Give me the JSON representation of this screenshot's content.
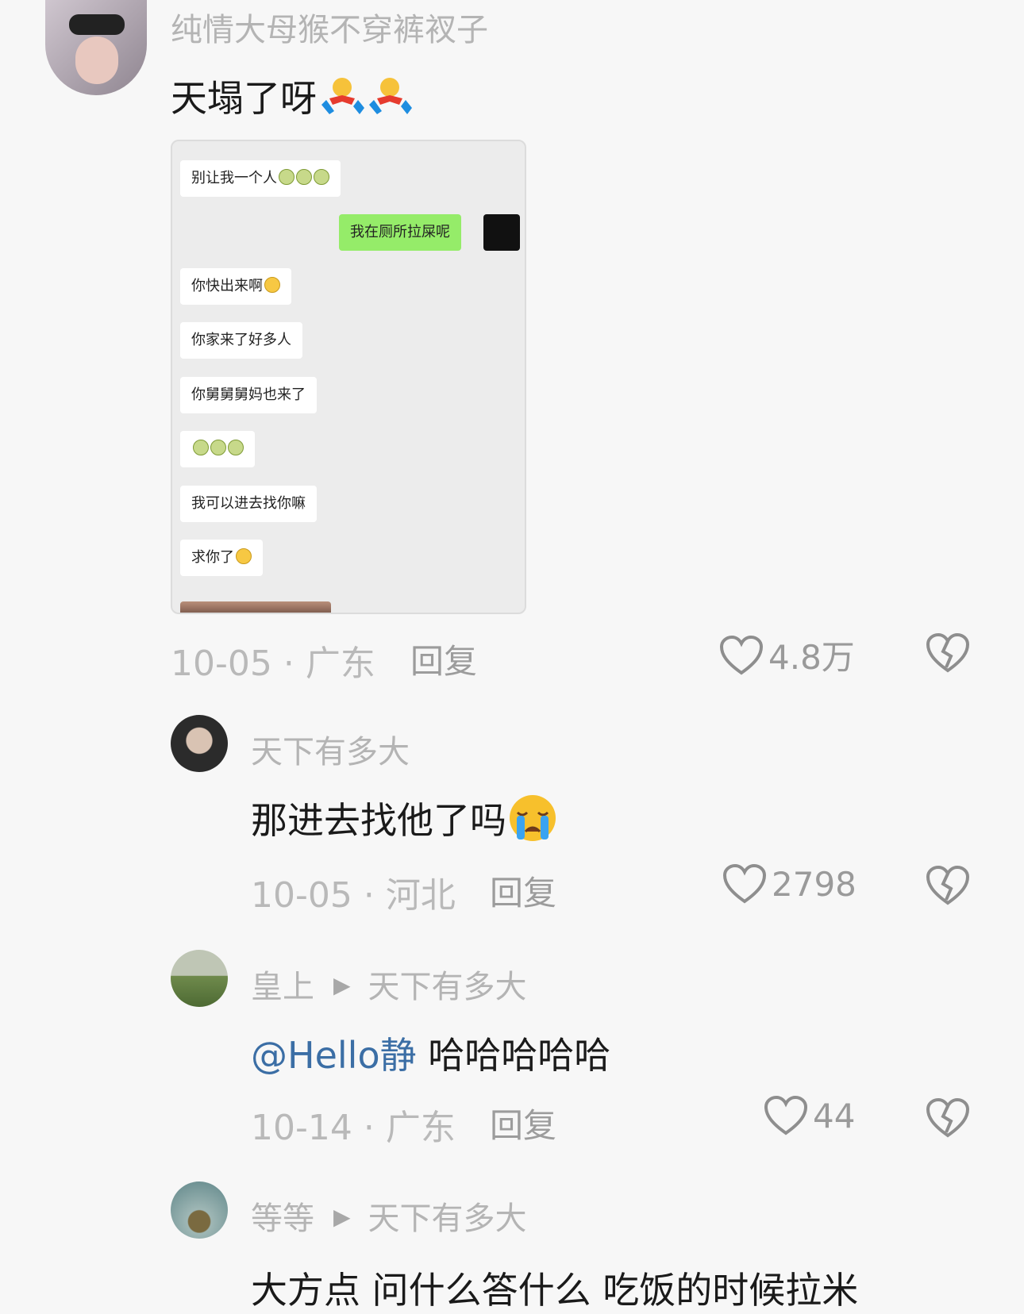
{
  "comments": [
    {
      "username": "纯情大母猴不穿裤衩子",
      "text": "天塌了呀",
      "date": "10-05",
      "location": "广东",
      "reply_label": "回复",
      "likes": "4.8万",
      "chat_screenshot": {
        "messages": [
          {
            "side": "left",
            "text": "别让我一个人",
            "emoji": [
              "cry-icon",
              "cry-icon",
              "cry-icon"
            ]
          },
          {
            "side": "right",
            "text": "我在厕所拉屎呢"
          },
          {
            "side": "left",
            "text": "你快出来啊",
            "emoji": [
              "angry-icon"
            ]
          },
          {
            "side": "left",
            "text": "你家来了好多人"
          },
          {
            "side": "left",
            "text": "你舅舅舅妈也来了"
          },
          {
            "side": "left",
            "text": "",
            "emoji": [
              "cry-icon",
              "cry-icon",
              "cry-icon"
            ]
          },
          {
            "side": "left",
            "text": "我可以进去找你嘛"
          },
          {
            "side": "left",
            "text": "求你了",
            "emoji": [
              "pleading-icon"
            ]
          }
        ]
      }
    },
    {
      "username": "天下有多大",
      "text": "那进去找他了吗",
      "date": "10-05",
      "location": "河北",
      "reply_label": "回复",
      "likes": "2798"
    },
    {
      "username": "皇上",
      "reply_to": "天下有多大",
      "mention": "@Hello静",
      "text": " 哈哈哈哈哈",
      "date": "10-14",
      "location": "广东",
      "reply_label": "回复",
      "likes": "44"
    },
    {
      "username": "等等",
      "reply_to": "天下有多大",
      "text": "大方点 问什么答什么 吃饭的时候拉米"
    }
  ],
  "colors": {
    "background": "#f7f7f7",
    "mention": "#3b6ea5",
    "wechat_green": "#95ec69"
  }
}
